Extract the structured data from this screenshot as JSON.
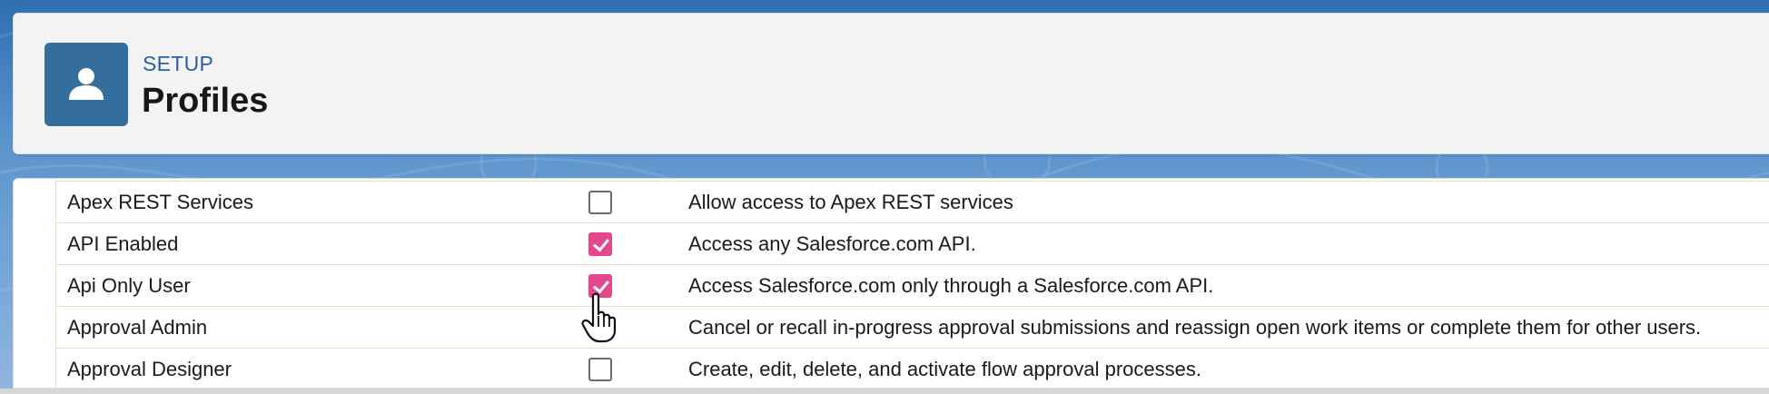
{
  "header": {
    "eyebrow": "SETUP",
    "title": "Profiles",
    "icon": "user-icon"
  },
  "permissions": [
    {
      "name": "Apex REST Services",
      "checked": false,
      "description": "Allow access to Apex REST services"
    },
    {
      "name": "API Enabled",
      "checked": true,
      "description": "Access any Salesforce.com API."
    },
    {
      "name": "Api Only User",
      "checked": true,
      "description": "Access Salesforce.com only through a Salesforce.com API."
    },
    {
      "name": "Approval Admin",
      "checked": false,
      "description": "Cancel or recall in-progress approval submissions and reassign open work items or complete them for other users."
    },
    {
      "name": "Approval Designer",
      "checked": false,
      "description": "Create, edit, delete, and activate flow approval processes."
    }
  ],
  "colors": {
    "checked": "#e3488c",
    "header_icon_bg": "#336e9c",
    "eyebrow": "#2a5ea7"
  },
  "cursor": "hand-pointer-icon"
}
